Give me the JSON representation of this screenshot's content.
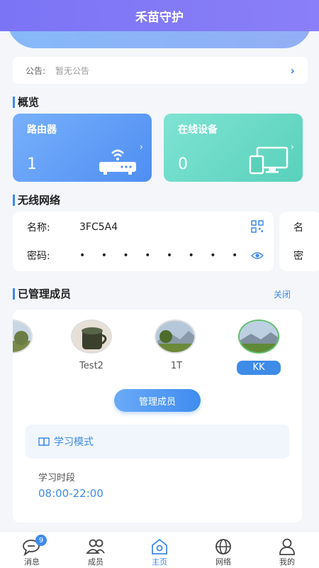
{
  "app": {
    "title": "禾苗守护"
  },
  "notice": {
    "label": "公告:",
    "value": "暂无公告"
  },
  "overview": {
    "title": "概览",
    "router": {
      "label": "路由器",
      "count": "1"
    },
    "devices": {
      "label": "在线设备",
      "count": "0"
    }
  },
  "wireless": {
    "title": "无线网络",
    "name_label": "名称:",
    "name_value": "3FC5A4",
    "password_label": "密码:",
    "password_value": "• • • • • • • •",
    "second_name_label": "名",
    "second_password_label": "密"
  },
  "members": {
    "title": "已管理成员",
    "close_label": "关闭",
    "items": [
      {
        "name": ""
      },
      {
        "name": "Test2"
      },
      {
        "name": "1T"
      },
      {
        "name": "KK",
        "selected": true
      }
    ],
    "manage_button": "管理成员",
    "study_mode": "学习模式",
    "study_period_label": "学习时段",
    "study_period_value": "08:00-22:00"
  },
  "tabs": [
    {
      "label": "消息",
      "badge": "9"
    },
    {
      "label": "成员"
    },
    {
      "label": "主页",
      "active": true
    },
    {
      "label": "网络"
    },
    {
      "label": "我的"
    }
  ],
  "colors": {
    "accent": "#3e8be8",
    "header": "#7b74f5",
    "router_card": "#4f8ef2",
    "device_card": "#58d1bb"
  }
}
